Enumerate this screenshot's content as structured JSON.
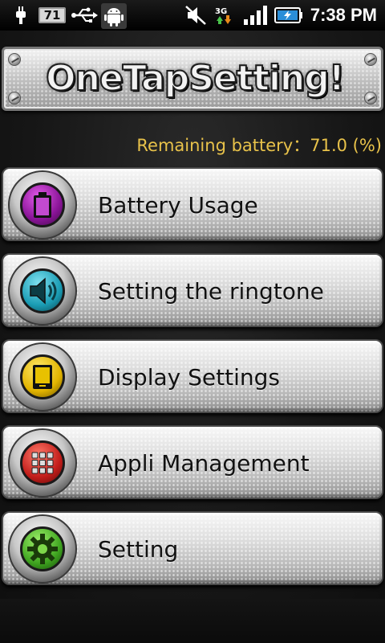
{
  "status_bar": {
    "battery_count": "71",
    "time": "7:38 PM",
    "icons": [
      "usb-debug-icon",
      "battery-level-icon",
      "usb-icon",
      "android-icon",
      "mute-icon",
      "3g-data-icon",
      "signal-bars-icon",
      "battery-charging-icon"
    ]
  },
  "header": {
    "title": "OneTapSetting!"
  },
  "battery_status": {
    "text": "Remaining battery：71.0 (%)"
  },
  "menu": {
    "items": [
      {
        "label": "Battery Usage",
        "icon": "battery-icon",
        "color": "#8a1498"
      },
      {
        "label": "Setting the ringtone",
        "icon": "speaker-icon",
        "color": "#1a9cb4"
      },
      {
        "label": "Display Settings",
        "icon": "display-icon",
        "color": "#e2b400"
      },
      {
        "label": "Appli Management",
        "icon": "app-grid-icon",
        "color": "#c21d1a"
      },
      {
        "label": "Setting",
        "icon": "gear-icon",
        "color": "#3fa420"
      }
    ]
  }
}
